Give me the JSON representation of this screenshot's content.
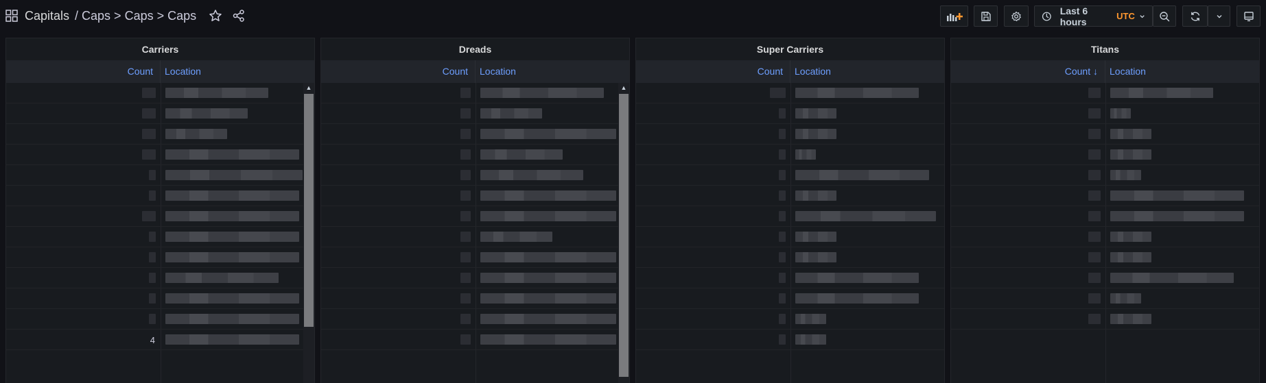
{
  "breadcrumb": {
    "folder": "Capitals",
    "path": "/ Caps > Caps > Caps"
  },
  "toolbar": {
    "time_range": "Last 6 hours",
    "timezone": "UTC"
  },
  "panels": [
    {
      "title": "Carriers",
      "count_header": "Count",
      "location_header": "Location"
    },
    {
      "title": "Dreads",
      "count_header": "Count",
      "location_header": "Location"
    },
    {
      "title": "Super Carriers",
      "count_header": "Count",
      "location_header": "Location"
    },
    {
      "title": "Titans",
      "count_header": "Count ↓",
      "location_header": "Location"
    }
  ],
  "partial_values": {
    "carriers_last_count": "4"
  },
  "colors": {
    "background": "#111217",
    "panel": "#181b1f",
    "header_link": "#6e9fff",
    "timezone": "#ff9830"
  }
}
